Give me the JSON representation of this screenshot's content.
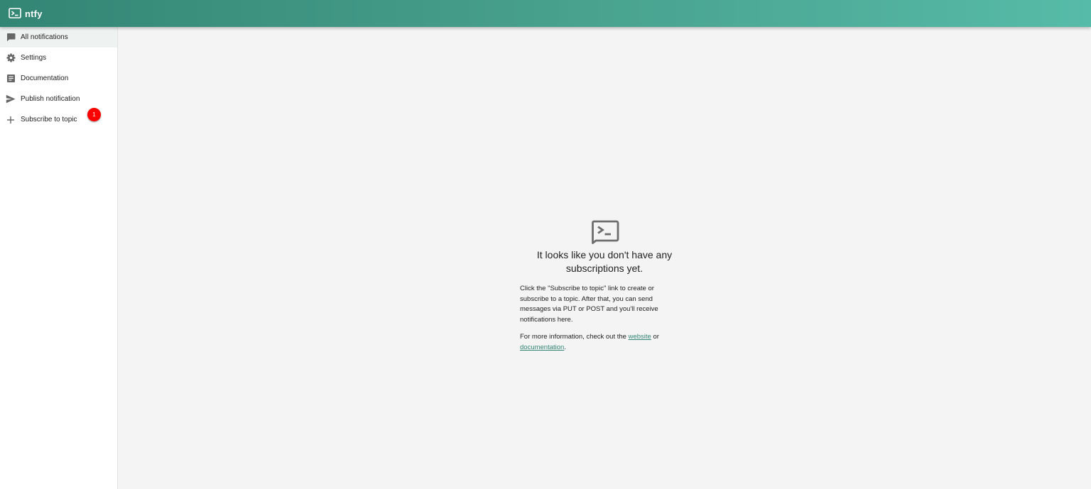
{
  "app": {
    "title": "ntfy",
    "logo_icon": "terminal-chat-icon",
    "header_gradient": [
      "#338574",
      "#56bba8"
    ],
    "accent": "#338574"
  },
  "sidebar": {
    "items": [
      {
        "label": "All notifications",
        "icon": "chat-icon",
        "selected": true
      },
      {
        "label": "Settings",
        "icon": "gear-icon"
      },
      {
        "label": "Documentation",
        "icon": "article-icon"
      },
      {
        "label": "Publish notification",
        "icon": "send-icon"
      },
      {
        "label": "Subscribe to topic",
        "icon": "plus-icon"
      }
    ],
    "badge": {
      "value": "1",
      "color": "#ff0000"
    }
  },
  "empty_state": {
    "icon": "terminal-chat-icon",
    "title": "It looks like you don't have any subscriptions yet.",
    "description": "Click the \"Subscribe to topic\" link to create or subscribe to a topic. After that, you can send messages via PUT or POST and you'll receive notifications here.",
    "more_prefix": "For more information, check out the ",
    "website_link": "website",
    "more_or": " or ",
    "documentation_link": "documentation",
    "more_suffix": "."
  }
}
